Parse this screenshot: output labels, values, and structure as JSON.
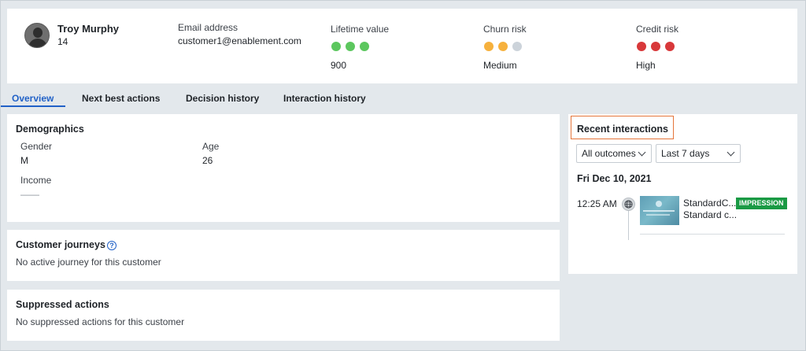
{
  "customer": {
    "name": "Troy Murphy",
    "id": "14",
    "email_label": "Email address",
    "email": "customer1@enablement.com"
  },
  "metrics": {
    "lifetime": {
      "label": "Lifetime value",
      "value": "900",
      "dots": [
        "#5cc75e",
        "#5cc75e",
        "#5cc75e"
      ]
    },
    "churn": {
      "label": "Churn risk",
      "value": "Medium",
      "dots": [
        "#f6b13d",
        "#f6b13d",
        "#ccd3da"
      ]
    },
    "credit": {
      "label": "Credit risk",
      "value": "High",
      "dots": [
        "#d8383a",
        "#d8383a",
        "#d8383a"
      ]
    }
  },
  "tabs": {
    "overview": "Overview",
    "next_best": "Next best actions",
    "decision": "Decision history",
    "interaction": "Interaction history"
  },
  "demographics": {
    "title": "Demographics",
    "gender_label": "Gender",
    "gender": "M",
    "age_label": "Age",
    "age": "26",
    "income_label": "Income",
    "income": "——"
  },
  "journeys": {
    "title": "Customer journeys",
    "help": "?",
    "text": "No active journey for this customer"
  },
  "suppressed": {
    "title": "Suppressed actions",
    "text": "No suppressed actions for this customer"
  },
  "recent": {
    "title": "Recent interactions",
    "outcomes": "All outcomes",
    "period": "Last 7 days",
    "date": "Fri Dec 10, 2021",
    "time": "12:25 AM",
    "item_title": "StandardC...",
    "item_subtitle": "Standard c...",
    "badge": "IMPRESSION",
    "badge_color": "#1a9a44"
  },
  "accent": "#2161c7",
  "highlight": "#e5753a"
}
